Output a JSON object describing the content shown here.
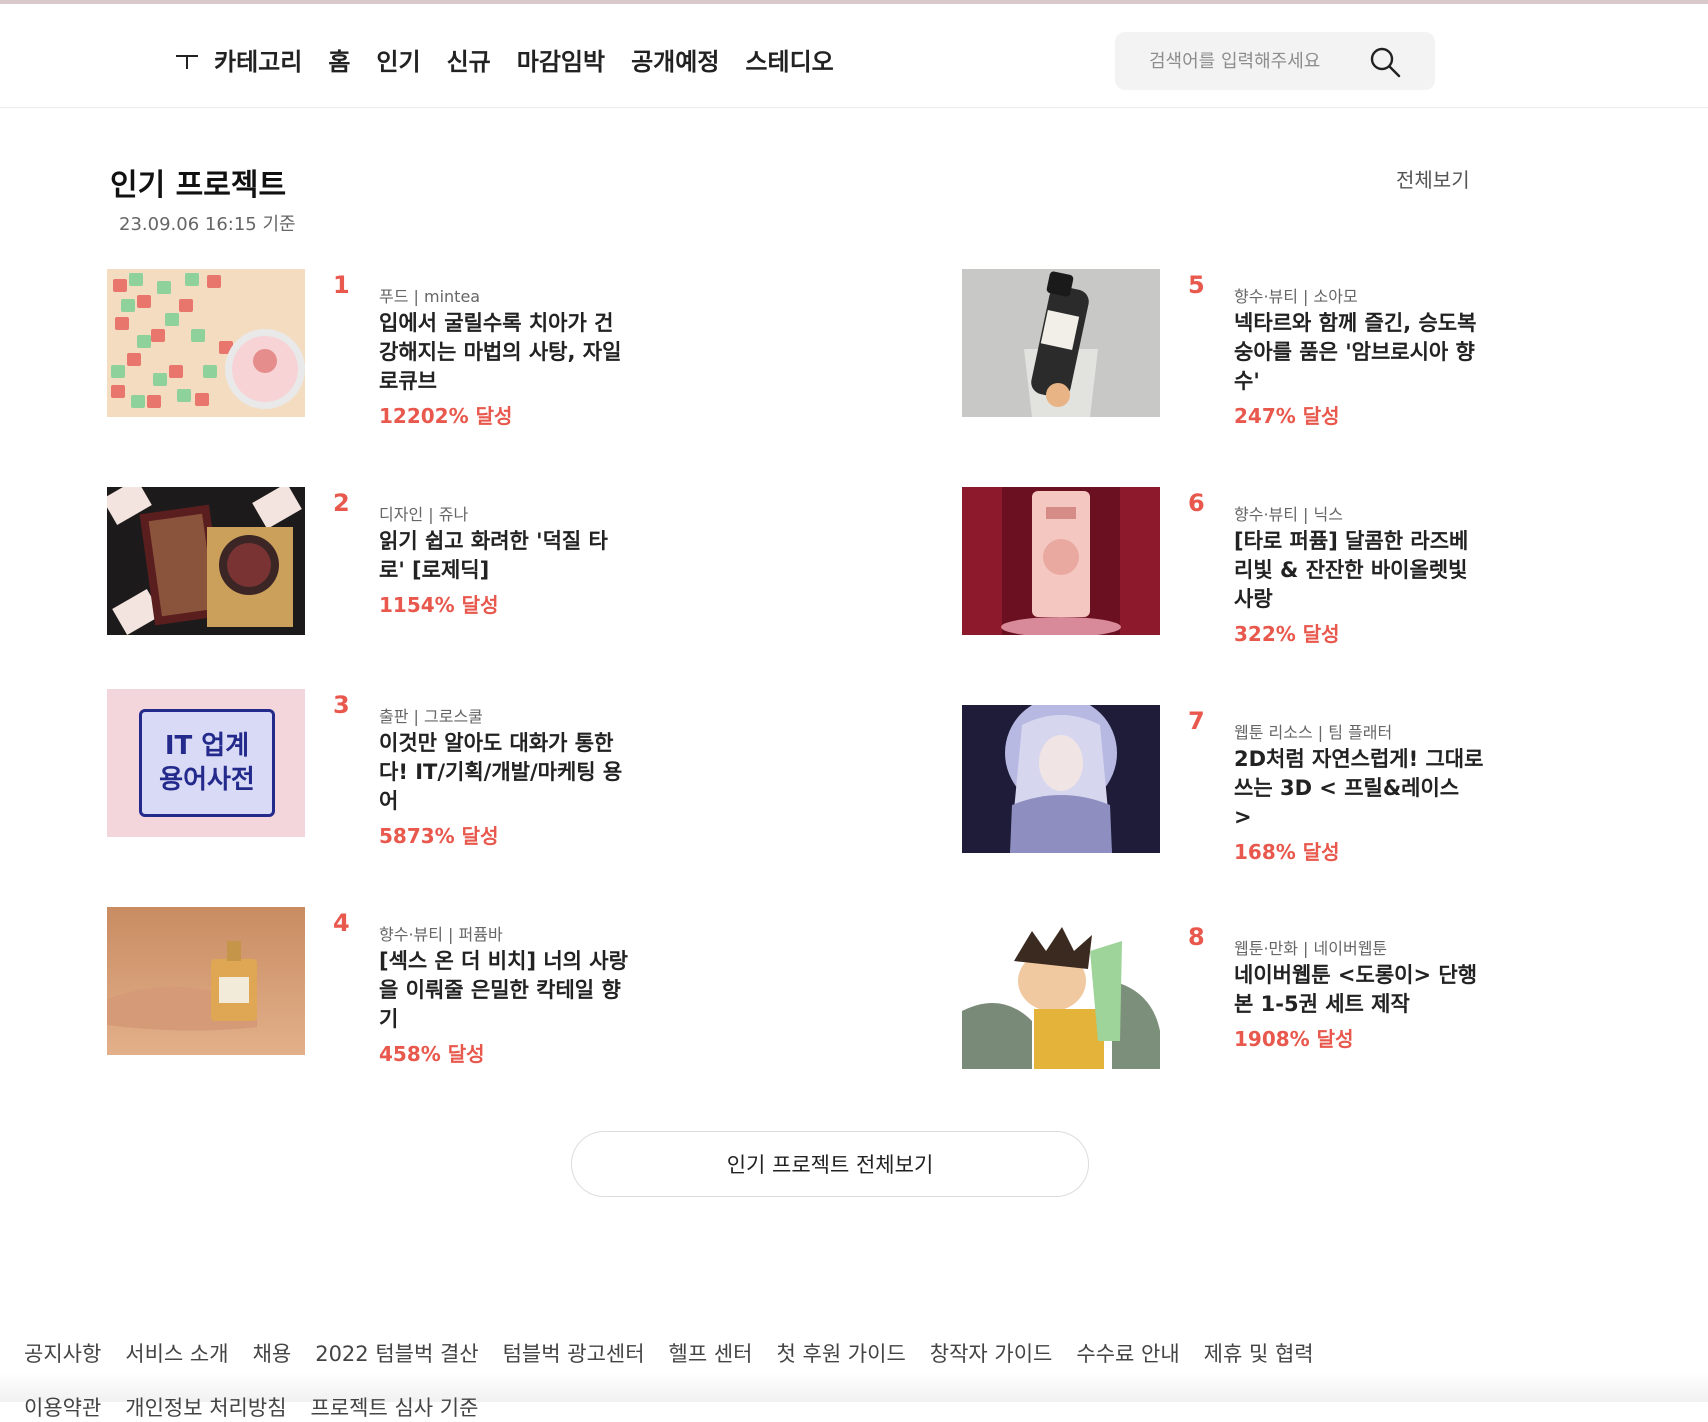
{
  "header": {
    "nav": [
      "카테고리",
      "홈",
      "인기",
      "신규",
      "마감임박",
      "공개예정",
      "스테디오"
    ],
    "search_placeholder": "검색어를 입력해주세요"
  },
  "section": {
    "title": "인기 프로젝트",
    "timestamp": "23.09.06 16:15 기준",
    "view_all": "전체보기"
  },
  "projects": [
    {
      "rank": "1",
      "category": "푸드 | mintea",
      "title": "입에서 굴릴수록 치아가 건강해지는 마법의 사탕, 자일로큐브",
      "rate": "12202% 달성"
    },
    {
      "rank": "2",
      "category": "디자인 | 쥬나",
      "title": "읽기 쉽고 화려한 '덕질 타로' [로제딕]",
      "rate": "1154% 달성"
    },
    {
      "rank": "3",
      "category": "출판 | 그로스쿨",
      "title": "이것만 알아도 대화가 통한다! IT/기획/개발/마케팅 용어",
      "rate": "5873% 달성",
      "thumb_text": [
        "IT 업계",
        "용어사전"
      ]
    },
    {
      "rank": "4",
      "category": "향수·뷰티 | 퍼퓸바",
      "title": "[섹스 온 더 비치] 너의 사랑을 이뤄줄 은밀한 칵테일 향기",
      "rate": "458% 달성"
    },
    {
      "rank": "5",
      "category": "향수·뷰티 | 소아모",
      "title": "넥타르와 함께 즐긴, 승도복숭아를 품은 '암브로시아 향수'",
      "rate": "247% 달성"
    },
    {
      "rank": "6",
      "category": "향수·뷰티 | 닉스",
      "title": "[타로 퍼퓸] 달콤한 라즈베리빛 & 잔잔한 바이올렛빛 사랑",
      "rate": "322% 달성"
    },
    {
      "rank": "7",
      "category": "웹툰 리소스 | 팀 플래터",
      "title": "2D처럼 자연스럽게! 그대로 쓰는 3D < 프릴&레이스 >",
      "rate": "168% 달성"
    },
    {
      "rank": "8",
      "category": "웹툰·만화 | 네이버웹툰",
      "title": "네이버웹툰 <도롱이> 단행본 1-5권 세트 제작",
      "rate": "1908% 달성"
    }
  ],
  "more_button": "인기 프로젝트 전체보기",
  "footer": {
    "links": [
      "공지사항",
      "서비스 소개",
      "채용",
      "2022 텀블벅 결산",
      "텀블벅 광고센터",
      "헬프 센터",
      "첫 후원 가이드",
      "창작자 가이드",
      "수수료 안내",
      "제휴 및 협력"
    ],
    "links2": [
      "이용약관",
      "개인정보 처리방침",
      "프로젝트 심사 기준"
    ]
  },
  "colors": {
    "accent": "#e8584d",
    "text": "#222222",
    "muted": "#666666"
  }
}
